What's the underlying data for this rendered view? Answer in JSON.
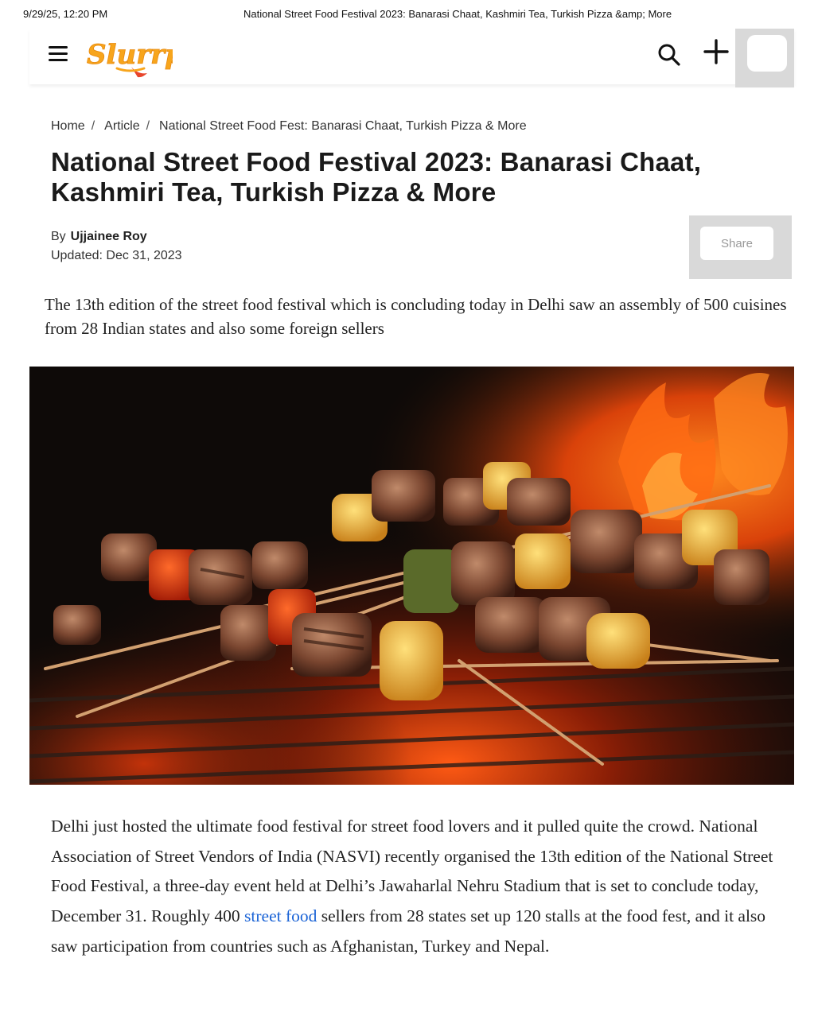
{
  "print_header": {
    "datetime": "9/29/25, 12:20 PM",
    "doc_title": "National Street Food Festival 2023: Banarasi Chaat, Kashmiri Tea, Turkish Pizza &amp; More"
  },
  "header": {
    "logo_text": "Slurrp",
    "menu_icon": "hamburger-menu-icon",
    "search_icon": "search-icon",
    "plus_icon": "plus-icon"
  },
  "breadcrumb": {
    "home": "Home",
    "sep": "/",
    "article": "Article",
    "current": "National Street Food Fest: Banarasi Chaat, Turkish Pizza & More"
  },
  "article": {
    "title": "National Street Food Festival 2023: Banarasi Chaat, Kashmiri Tea, Turkish Pizza & More",
    "by_label": "By",
    "author": "Ujjainee Roy",
    "updated": "Updated: Dec 31, 2023",
    "share_label": "Share",
    "lede": "The 13th edition of the street food festival which is concluding today in Delhi saw an assembly of 500 cuisines from 28 Indian states and also some foreign sellers",
    "body_before_link": "Delhi just hosted the ultimate food festival for street food lovers and it pulled quite the crowd. National Association of Street Vendors of India (NASVI) recently organised the 13th edition of the National Street Food Festival, a three-day event held at Delhi’s Jawaharlal Nehru Stadium that is set to conclude today, December 31. Roughly 400 ",
    "body_link": "street food",
    "body_after_link": " sellers from 28 states set up 120 stalls at the food fest, and it also saw participation from countries such as Afghanistan, Turkey and Nepal."
  },
  "colors": {
    "link": "#1a63d6",
    "logo_orange": "#f7a51c",
    "logo_red": "#e8452c"
  }
}
